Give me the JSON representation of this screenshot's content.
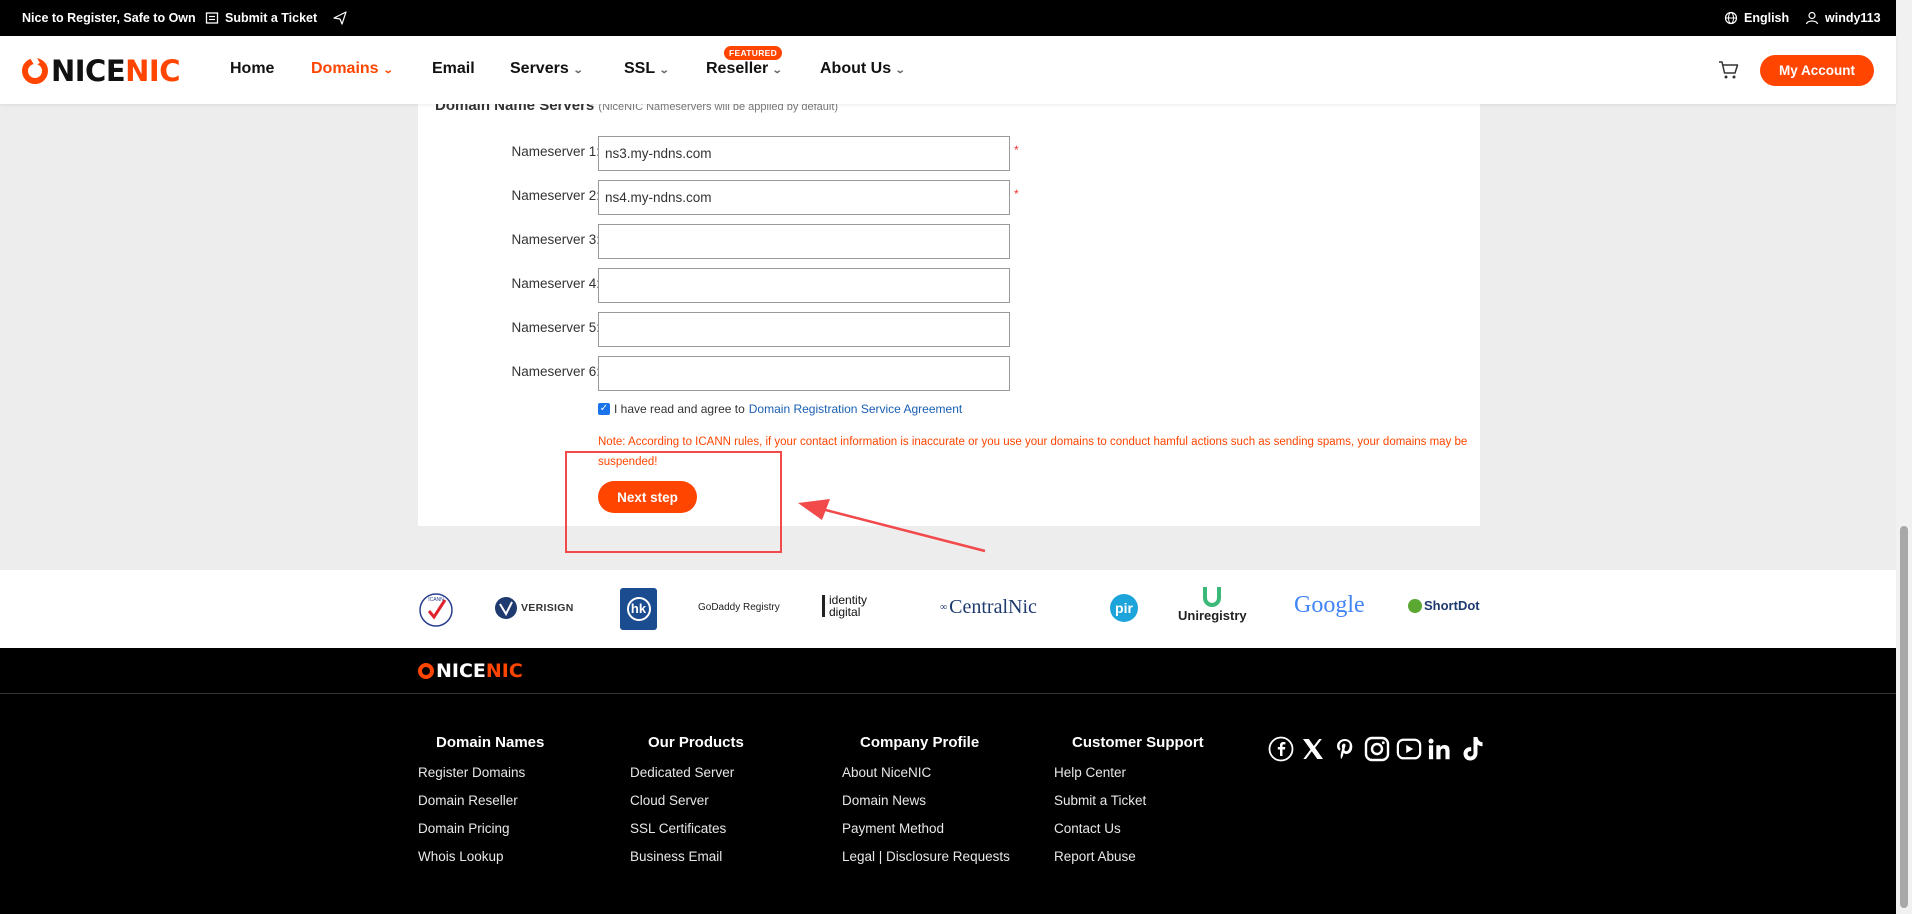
{
  "topbar": {
    "slogan": "Nice to Register, Safe to Own",
    "submit_ticket": "Submit a Ticket",
    "language": "English",
    "username": "windy113"
  },
  "nav": {
    "logo_nice": "NICE",
    "logo_nic": "NIC",
    "items": [
      {
        "label": "Home"
      },
      {
        "label": "Domains"
      },
      {
        "label": "Email"
      },
      {
        "label": "Servers"
      },
      {
        "label": "SSL"
      },
      {
        "label": "Reseller"
      },
      {
        "label": "About Us"
      }
    ],
    "featured_badge": "FEATURED",
    "account_button": "My Account",
    "accent": "#ff4500"
  },
  "form": {
    "section_title": "Domain Name Servers",
    "section_note": "(NiceNIC Nameservers will be applied by default)",
    "nameservers": [
      {
        "label": "Nameserver 1:",
        "value": "ns3.my-ndns.com",
        "required": "*"
      },
      {
        "label": "Nameserver 2:",
        "value": "ns4.my-ndns.com",
        "required": "*"
      },
      {
        "label": "Nameserver 3:",
        "value": ""
      },
      {
        "label": "Nameserver 4:",
        "value": ""
      },
      {
        "label": "Nameserver 5:",
        "value": ""
      },
      {
        "label": "Nameserver 6:",
        "value": ""
      }
    ],
    "agree_text": "I have read and agree to",
    "agree_link": "Domain Registration Service Agreement",
    "agree_checked": true,
    "note": "Note: According to ICANN rules, if your contact information is inaccurate or you use your domains to conduct hamful actions such as sending spams, your domains may be suspended!",
    "next_button": "Next step"
  },
  "partners": {
    "icann": "ICANN",
    "verisign": "VERISIGN",
    "hk": "hk",
    "godaddy": "GoDaddy Registry",
    "identity_1": "identity",
    "identity_2": "digital",
    "centralnic": "CentralNic",
    "pir": "pir",
    "uniregistry": "Uniregistry",
    "google": "Google",
    "shortdot": "ShortDot"
  },
  "footer": {
    "logo_nice": "NICE",
    "logo_nic": "NIC",
    "columns": [
      {
        "title": "Domain Names",
        "links": [
          "Register Domains",
          "Domain Reseller",
          "Domain Pricing",
          "Whois Lookup"
        ]
      },
      {
        "title": "Our Products",
        "links": [
          "Dedicated Server",
          "Cloud Server",
          "SSL Certificates",
          "Business Email"
        ]
      },
      {
        "title": "Company Profile",
        "links": [
          "About NiceNIC",
          "Domain News",
          "Payment Method",
          "Legal | Disclosure Requests"
        ]
      },
      {
        "title": "Customer Support",
        "links": [
          "Help Center",
          "Submit a Ticket",
          "Contact Us",
          "Report Abuse"
        ]
      }
    ],
    "social_icons": [
      "facebook-icon",
      "x-icon",
      "pinterest-icon",
      "instagram-icon",
      "youtube-icon",
      "linkedin-icon",
      "tiktok-icon"
    ]
  },
  "annotation_color": "#f2494b"
}
